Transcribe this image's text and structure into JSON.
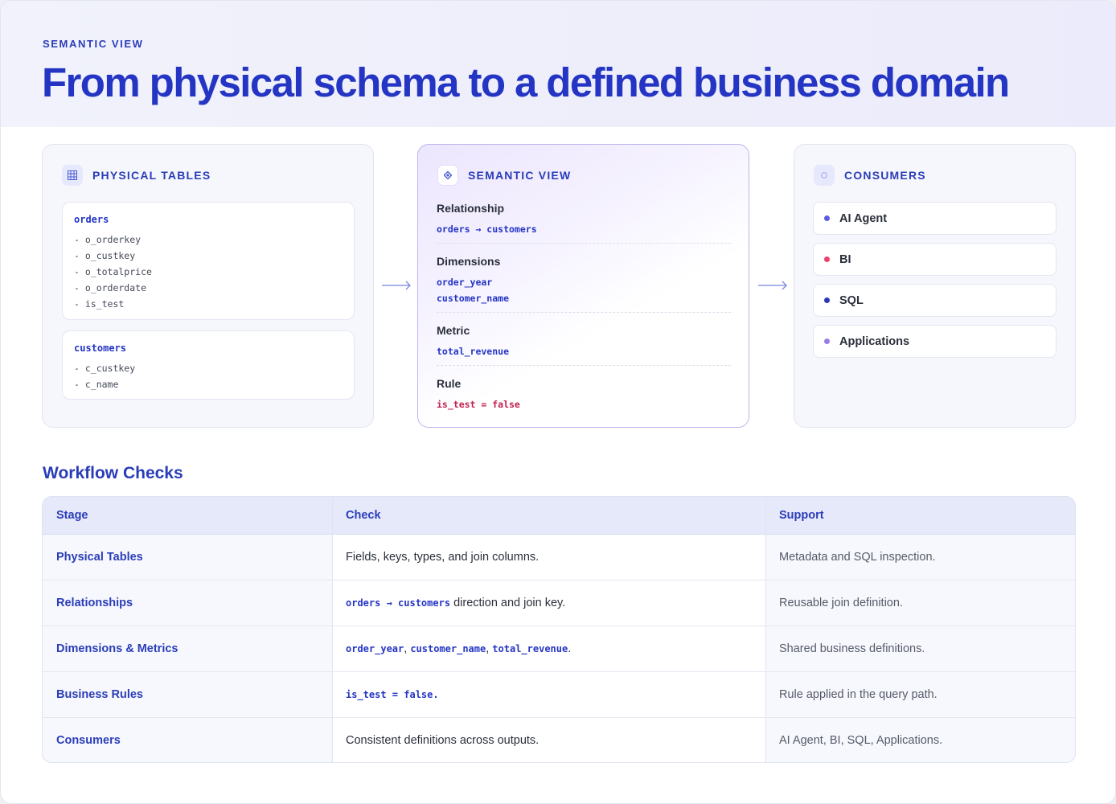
{
  "header": {
    "eyebrow": "SEMANTIC VIEW",
    "title": "From physical schema to a defined business domain"
  },
  "physical_tables": {
    "title": "PHYSICAL TABLES",
    "icon": "table-grid-icon",
    "tables": [
      {
        "name": "orders",
        "fields": [
          "- o_orderkey",
          "- o_custkey",
          "- o_totalprice",
          "- o_orderdate",
          "- is_test"
        ]
      },
      {
        "name": "customers",
        "fields": [
          "- c_custkey",
          "- c_name"
        ]
      }
    ]
  },
  "semantic_view": {
    "title": "SEMANTIC VIEW",
    "icon": "diamond-icon",
    "relationship": {
      "label": "Relationship",
      "value": "orders → customers"
    },
    "dimensions": {
      "label": "Dimensions",
      "values": [
        "order_year",
        "customer_name"
      ]
    },
    "metric": {
      "label": "Metric",
      "value": "total_revenue"
    },
    "rule": {
      "label": "Rule",
      "value": "is_test = false"
    }
  },
  "consumers": {
    "title": "CONSUMERS",
    "icon": "circle-icon",
    "items": [
      {
        "label": "AI Agent",
        "color": "#5b5ce6"
      },
      {
        "label": "BI",
        "color": "#ef3f6b"
      },
      {
        "label": "SQL",
        "color": "#2a38b8"
      },
      {
        "label": "Applications",
        "color": "#9b7be6"
      }
    ]
  },
  "workflow": {
    "title": "Workflow Checks",
    "columns": [
      "Stage",
      "Check",
      "Support"
    ],
    "rows": [
      {
        "stage": "Physical Tables",
        "check": "Fields, keys, types, and join columns.",
        "support": "Metadata and SQL inspection."
      },
      {
        "stage": "Relationships",
        "check_code": "orders → customers",
        "check_text": " direction and join key.",
        "support": "Reusable join definition."
      },
      {
        "stage": "Dimensions & Metrics",
        "check_codes": [
          "order_year",
          "customer_name",
          "total_revenue"
        ],
        "support": "Shared business definitions."
      },
      {
        "stage": "Business Rules",
        "check_code": "is_test = false",
        "check_text": ".",
        "support": "Rule applied in the query path."
      },
      {
        "stage": "Consumers",
        "check": "Consistent definitions across outputs.",
        "support": "AI Agent, BI, SQL, Applications."
      }
    ]
  },
  "colors": {
    "accent": "#2435c4",
    "rule": "#c4204e"
  }
}
